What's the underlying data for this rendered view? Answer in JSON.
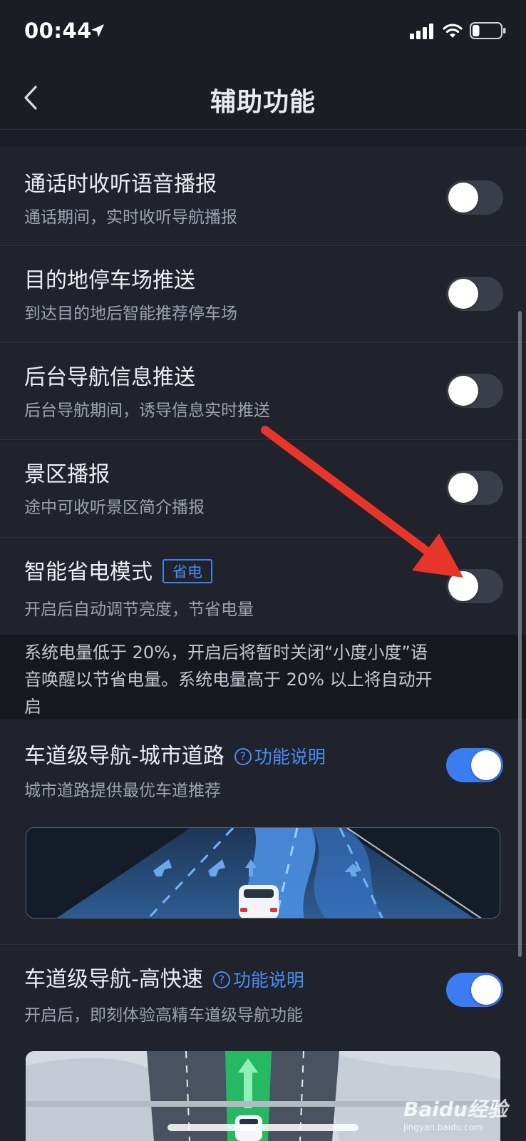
{
  "status_bar": {
    "time": "00:44",
    "icons": [
      "location-arrow-icon",
      "signal-icon",
      "wifi-icon",
      "battery-icon"
    ],
    "battery_level": 0.25
  },
  "nav": {
    "title": "辅助功能",
    "back_icon": "chevron-left-icon"
  },
  "settings": [
    {
      "title": "通话时收听语音播报",
      "subtitle": "通话期间，实时收听导航播报",
      "enabled": false
    },
    {
      "title": "目的地停车场推送",
      "subtitle": "到达目的地后智能推荐停车场",
      "enabled": false
    },
    {
      "title": "后台导航信息推送",
      "subtitle": "后台导航期间，诱导信息实时推送",
      "enabled": false
    },
    {
      "title": "景区播报",
      "subtitle": "途中可收听景区简介播报",
      "enabled": false
    },
    {
      "title": "智能省电模式",
      "badge": "省电",
      "subtitle": "开启后自动调节亮度，节省电量",
      "enabled": false
    },
    {
      "title": "车道级导航-城市道路",
      "help_label": "功能说明",
      "subtitle": "城市道路提供最优车道推荐",
      "enabled": true
    },
    {
      "title": "车道级导航-高快速",
      "help_label": "功能说明",
      "subtitle": "开启后，即刻体验高精车道级导航功能",
      "enabled": true
    }
  ],
  "power_note": {
    "line1": "系统电量低于 20%，开启后将暂时关闭“小度小度”语",
    "line2": "音唤醒以节省电量。系统电量高于 20% 以上将自动开",
    "line3": "启"
  },
  "watermark": {
    "brand": "Baidu经验",
    "url": "jingyan.baidu.com"
  },
  "colors": {
    "accent": "#3b7cf2",
    "annotation_arrow": "#e8352a",
    "background": "#20232b"
  }
}
